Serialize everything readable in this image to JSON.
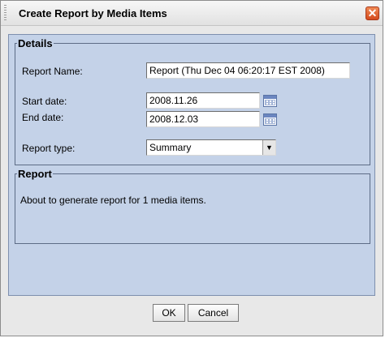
{
  "window": {
    "title": "Create Report by Media Items",
    "close_symbol": "✕"
  },
  "details": {
    "legend": "Details",
    "report_name_label": "Report Name:",
    "report_name_value": "Report (Thu Dec 04 06:20:17 EST 2008)",
    "start_date_label": "Start date:",
    "start_date_value": "2008.11.26",
    "end_date_label": "End date:",
    "end_date_value": "2008.12.03",
    "report_type_label": "Report type:",
    "report_type_value": "Summary",
    "dropdown_symbol": "▼"
  },
  "report": {
    "legend": "Report",
    "message": "About to generate report for 1 media items."
  },
  "buttons": {
    "ok": "OK",
    "cancel": "Cancel"
  }
}
